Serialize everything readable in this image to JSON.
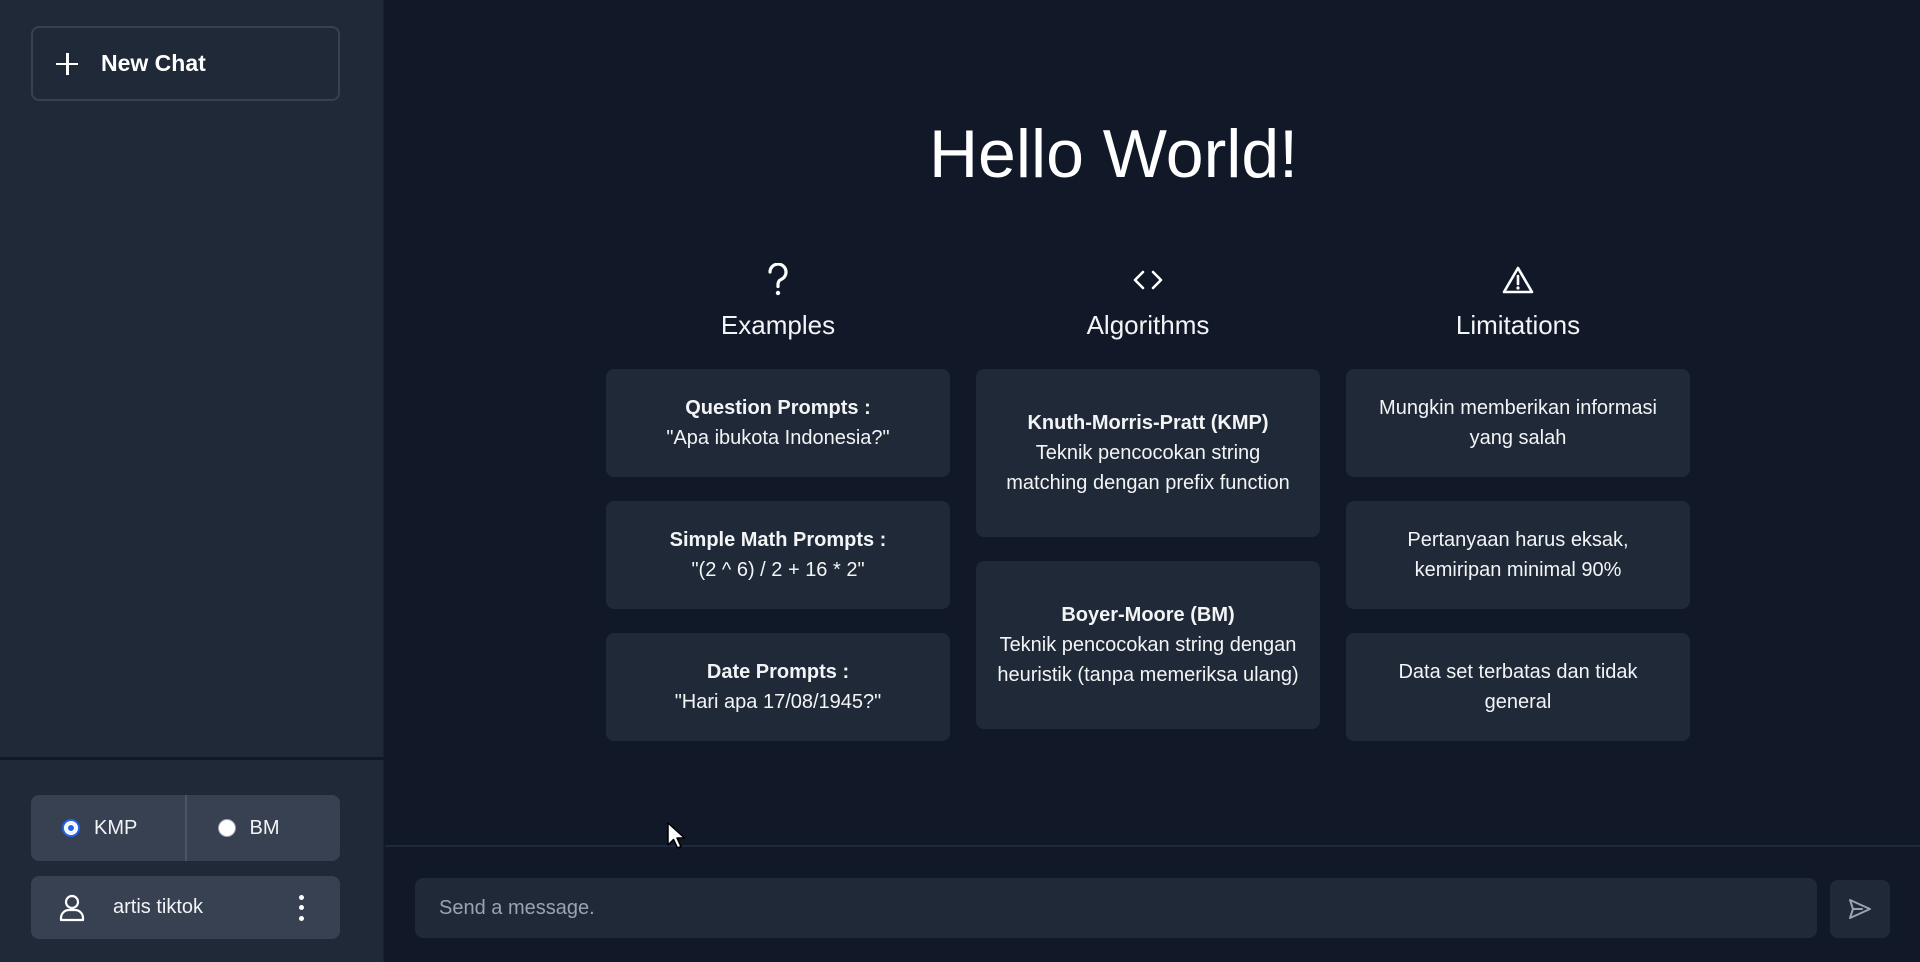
{
  "sidebar": {
    "new_chat_label": "New Chat",
    "algorithms": [
      {
        "label": "KMP",
        "checked": true
      },
      {
        "label": "BM",
        "checked": false
      }
    ],
    "user": {
      "name": "artis tiktok"
    }
  },
  "main": {
    "title": "Hello World!",
    "columns": [
      {
        "icon": "question-icon",
        "title": "Examples",
        "cards": [
          {
            "title": "Question Prompts :",
            "body": "\"Apa ibukota Indonesia?\""
          },
          {
            "title": "Simple Math Prompts :",
            "body": "\"(2 ^ 6) / 2 + 16 * 2\""
          },
          {
            "title": "Date Prompts :",
            "body": "\"Hari apa 17/08/1945?\""
          }
        ]
      },
      {
        "icon": "code-icon",
        "title": "Algorithms",
        "cards": [
          {
            "title": "Knuth-Morris-Pratt (KMP)",
            "body": "Teknik pencocokan string matching dengan prefix function"
          },
          {
            "title": "Boyer-Moore (BM)",
            "body": "Teknik pencocokan string dengan heuristik (tanpa memeriksa ulang)"
          }
        ]
      },
      {
        "icon": "warning-icon",
        "title": "Limitations",
        "cards": [
          {
            "body": "Mungkin memberikan informasi yang salah"
          },
          {
            "body": "Pertanyaan harus eksak, kemiripan minimal 90%"
          },
          {
            "body": "Data set terbatas dan tidak general"
          }
        ]
      }
    ]
  },
  "composer": {
    "placeholder": "Send a message.",
    "value": ""
  },
  "colors": {
    "sidebar_bg": "#1f2937",
    "main_bg": "#111827",
    "card_bg": "#1f2937",
    "accent": "#2563eb"
  }
}
